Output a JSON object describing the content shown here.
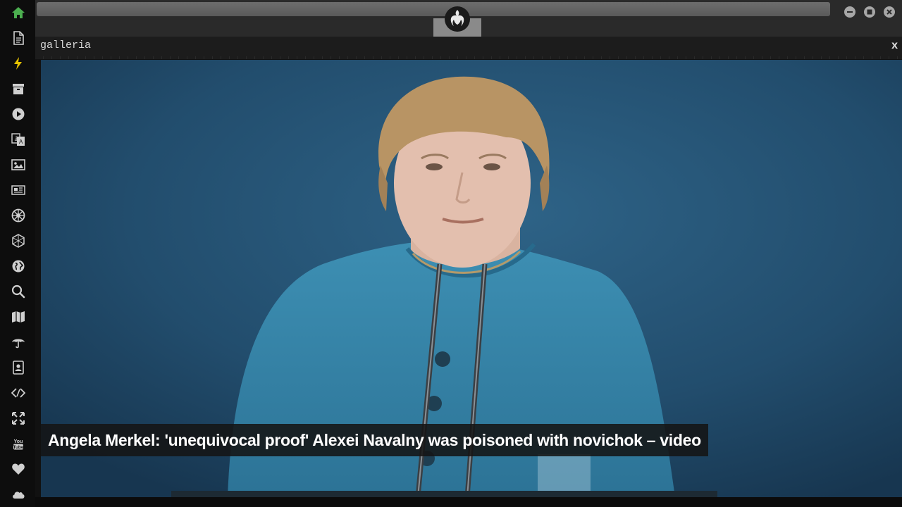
{
  "sidebar": {
    "items": [
      {
        "name": "home-icon",
        "color": "#4caf50"
      },
      {
        "name": "document-icon",
        "color": "#cfcfcf"
      },
      {
        "name": "bolt-icon",
        "color": "#e6c200"
      },
      {
        "name": "archive-icon",
        "color": "#cfcfcf"
      },
      {
        "name": "play-icon",
        "color": "#cfcfcf"
      },
      {
        "name": "translate-icon",
        "color": "#cfcfcf"
      },
      {
        "name": "image-icon",
        "color": "#cfcfcf"
      },
      {
        "name": "newspaper-icon",
        "color": "#cfcfcf"
      },
      {
        "name": "empire-icon",
        "color": "#cfcfcf"
      },
      {
        "name": "hexagon-grid-icon",
        "color": "#cfcfcf"
      },
      {
        "name": "globe-icon",
        "color": "#cfcfcf"
      },
      {
        "name": "search-icon",
        "color": "#cfcfcf"
      },
      {
        "name": "map-icon",
        "color": "#cfcfcf"
      },
      {
        "name": "umbrella-icon",
        "color": "#cfcfcf"
      },
      {
        "name": "contacts-icon",
        "color": "#cfcfcf"
      },
      {
        "name": "code-icon",
        "color": "#cfcfcf"
      },
      {
        "name": "expand-icon",
        "color": "#cfcfcf"
      },
      {
        "name": "youtube-icon",
        "color": "#cfcfcf"
      },
      {
        "name": "heart-icon",
        "color": "#cfcfcf"
      },
      {
        "name": "cloud-icon",
        "color": "#cfcfcf"
      }
    ]
  },
  "topbar": {
    "logo": "rebel-alliance-icon"
  },
  "panel": {
    "title": "galleria",
    "close_label": "x"
  },
  "gallery": {
    "caption": "Angela Merkel: 'unequivocal proof' Alexei Navalny was poisoned with novichok – video"
  }
}
